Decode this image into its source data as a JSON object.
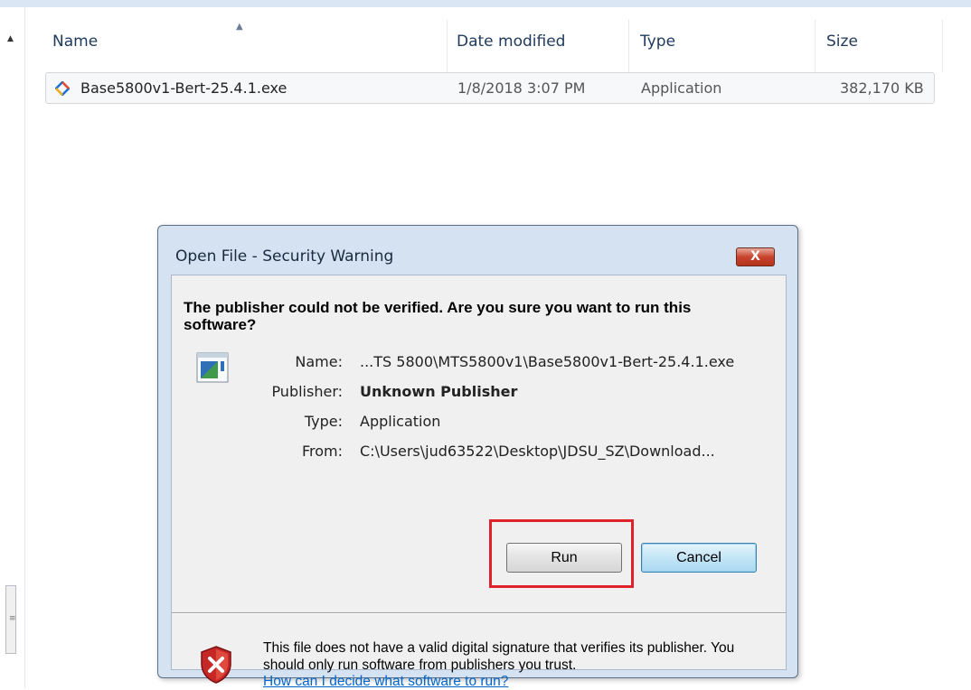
{
  "explorer": {
    "columns": {
      "name": "Name",
      "date": "Date modified",
      "type": "Type",
      "size": "Size"
    },
    "file": {
      "name": "Base5800v1-Bert-25.4.1.exe",
      "date": "1/8/2018 3:07 PM",
      "type": "Application",
      "size": "382,170 KB",
      "icon": "exe-installer-icon"
    }
  },
  "dialog": {
    "title": "Open File - Security Warning",
    "close_label": "X",
    "question": "The publisher could not be verified.  Are you sure you want to run this software?",
    "info": {
      "name_label": "Name:",
      "name_value": "...TS 5800\\MTS5800v1\\Base5800v1-Bert-25.4.1.exe",
      "publisher_label": "Publisher:",
      "publisher_value": "Unknown Publisher",
      "type_label": "Type:",
      "type_value": "Application",
      "from_label": "From:",
      "from_value": "C:\\Users\\jud63522\\Desktop\\JDSU_SZ\\Download..."
    },
    "run_label": "Run",
    "cancel_label": "Cancel",
    "warning_text": "This file does not have a valid digital signature that verifies its publisher.  You should only run software from publishers you trust.",
    "help_link": "How can I decide what software to run?",
    "highlight_color": "#e0202a"
  }
}
